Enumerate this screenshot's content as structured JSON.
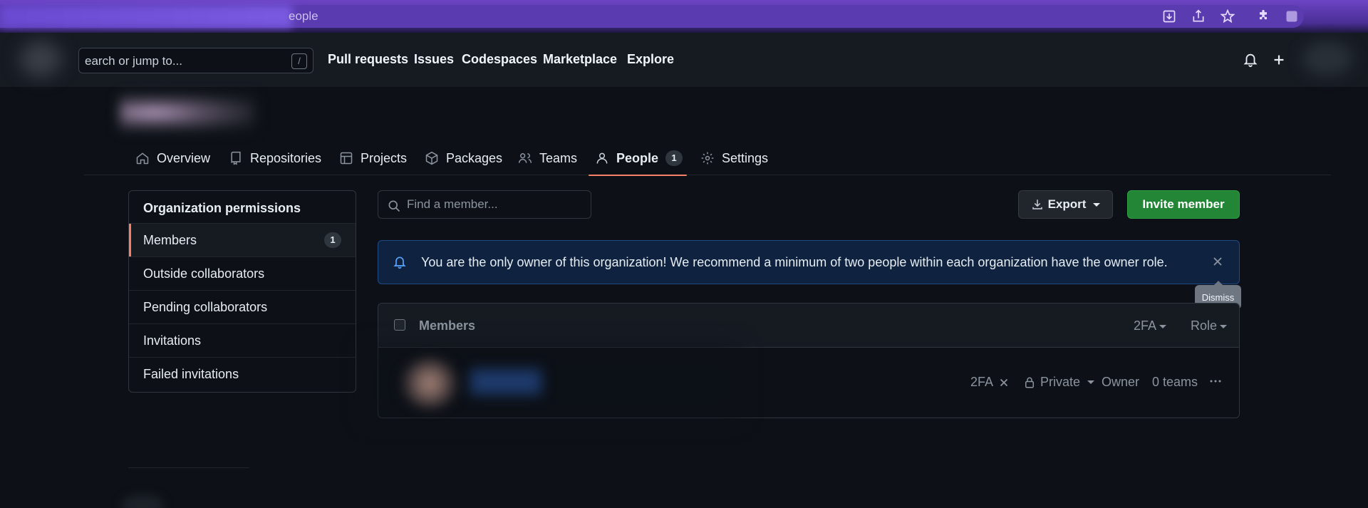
{
  "browser": {
    "url_visible": "eople"
  },
  "header": {
    "search_placeholder": "earch or jump to...",
    "search_shortcut": "/",
    "nav": [
      "Pull requests",
      "Issues",
      "Codespaces",
      "Marketplace",
      "Explore"
    ]
  },
  "tabs": [
    {
      "label": "Overview",
      "icon": "home-icon"
    },
    {
      "label": "Repositories",
      "icon": "repo-icon"
    },
    {
      "label": "Projects",
      "icon": "table-icon"
    },
    {
      "label": "Packages",
      "icon": "package-icon"
    },
    {
      "label": "Teams",
      "icon": "people-icon"
    },
    {
      "label": "People",
      "icon": "person-icon",
      "count": "1",
      "active": true
    },
    {
      "label": "Settings",
      "icon": "gear-icon"
    }
  ],
  "sidebar": {
    "heading": "Organization permissions",
    "items": [
      {
        "label": "Members",
        "count": "1",
        "selected": true
      },
      {
        "label": "Outside collaborators"
      },
      {
        "label": "Pending collaborators"
      },
      {
        "label": "Invitations"
      },
      {
        "label": "Failed invitations"
      }
    ]
  },
  "main": {
    "find_placeholder": "Find a member...",
    "export_label": "Export",
    "invite_label": "Invite member",
    "flash_message": "You are the only owner of this organization! We recommend a minimum of two people within each organization have the owner role.",
    "dismiss_tooltip": "Dismiss",
    "table": {
      "header_label": "Members",
      "filter_2fa": "2FA",
      "filter_role": "Role",
      "row": {
        "twofa": "2FA",
        "visibility": "Private",
        "role": "Owner",
        "teams": "0 teams"
      }
    }
  },
  "colors": {
    "accent_underline": "#f78166",
    "primary_button": "#238636",
    "flash_bg": "#0f2240",
    "flash_icon": "#58a6ff"
  }
}
